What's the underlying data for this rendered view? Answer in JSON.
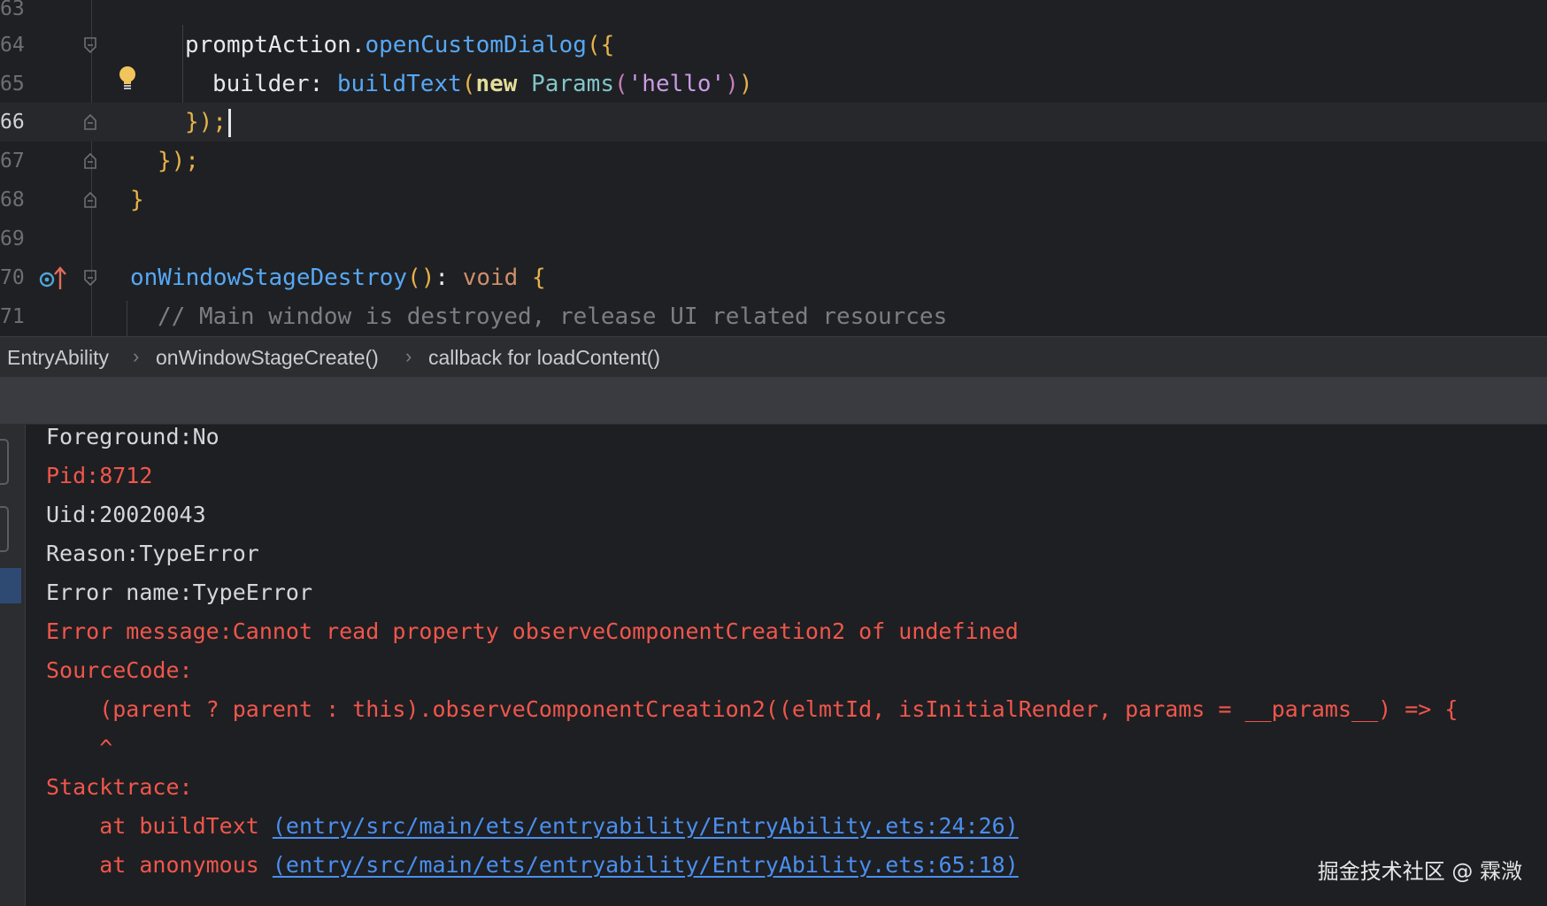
{
  "editor": {
    "lines": [
      {
        "number": "63"
      },
      {
        "number": "64",
        "t1": "promptAction",
        "t2": ".",
        "t3": "openCustomDialog",
        "t4": "(",
        "t5": "{"
      },
      {
        "number": "65",
        "t1": "builder: ",
        "t2": "buildText",
        "t3": "(",
        "t4": "new",
        "t5": " ",
        "t6": "Params",
        "t7": "(",
        "t8": "'hello'",
        "t9": ")",
        "t10": ")"
      },
      {
        "number": "66",
        "t1": "});"
      },
      {
        "number": "67",
        "t1": "});"
      },
      {
        "number": "68",
        "t1": "}"
      },
      {
        "number": "69"
      },
      {
        "number": "70",
        "t1": "onWindowStageDestroy",
        "t2": "()",
        "t3": ": ",
        "t4": "void",
        "t5": " ",
        "t6": "{"
      },
      {
        "number": "71",
        "t1": "// Main window is destroyed, release UI related resources"
      }
    ]
  },
  "breadcrumb": {
    "items": [
      "EntryAbility",
      "onWindowStageCreate()",
      "callback for loadContent()"
    ],
    "separator": "›"
  },
  "console": {
    "lines": [
      {
        "text": "Foreground:No",
        "kind": "normal"
      },
      {
        "text": "Pid:8712",
        "kind": "error"
      },
      {
        "text": "Uid:20020043",
        "kind": "normal"
      },
      {
        "text": "Reason:TypeError",
        "kind": "normal"
      },
      {
        "text": "Error name:TypeError",
        "kind": "normal"
      },
      {
        "text": "Error message:Cannot read property observeComponentCreation2 of undefined",
        "kind": "error"
      },
      {
        "text": "SourceCode:",
        "kind": "error"
      },
      {
        "text": "    (parent ? parent : this).observeComponentCreation2((elmtId, isInitialRender, params = __params__) => {",
        "kind": "error"
      },
      {
        "text": "    ^",
        "kind": "error"
      },
      {
        "text": "Stacktrace:",
        "kind": "error"
      }
    ],
    "stack": [
      {
        "prefix": "    at buildText ",
        "link": "(entry/src/main/ets/entryability/EntryAbility.ets:24:26)"
      },
      {
        "prefix": "    at anonymous ",
        "link": "(entry/src/main/ets/entryability/EntryAbility.ets:65:18)"
      }
    ]
  },
  "watermark": "掘金技术社区 @ 霖溦",
  "colors": {
    "error": "#f0564c",
    "link": "#4a8ff0",
    "function": "#56a8f5",
    "string": "#c99be6",
    "keyword": "#cf8e6d"
  }
}
